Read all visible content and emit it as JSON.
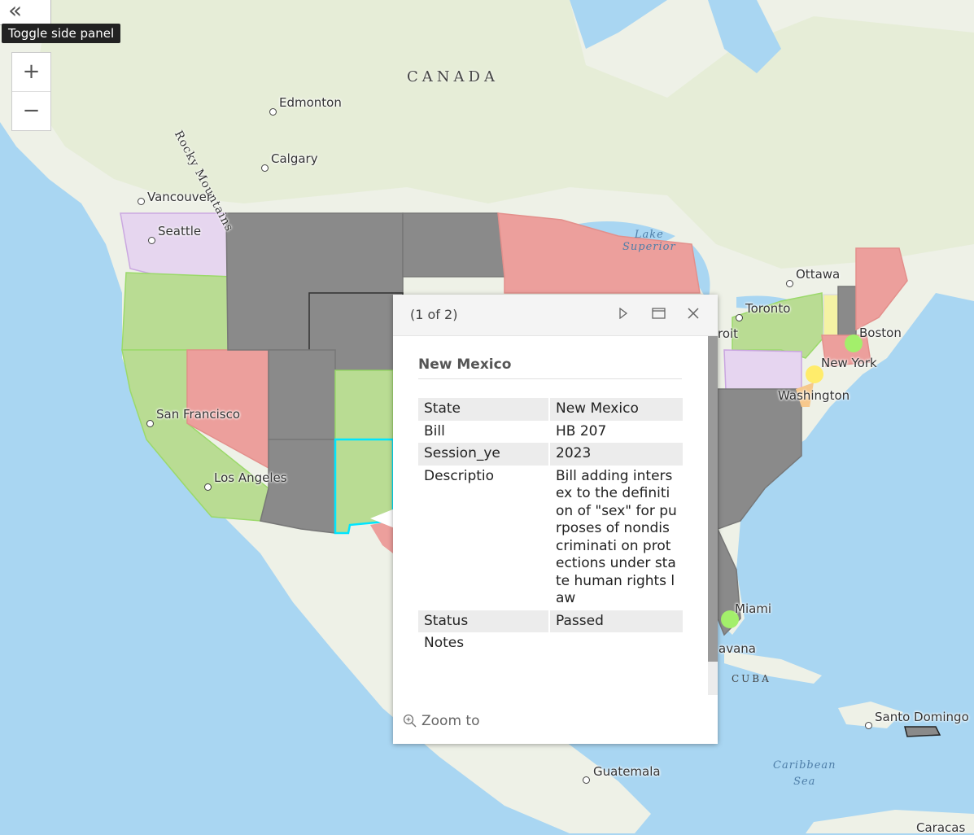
{
  "panel": {
    "toggle_icon": "chevron-double-left-icon",
    "tooltip": "Toggle side panel"
  },
  "zoom": {
    "in_label": "+",
    "out_label": "−"
  },
  "map": {
    "country_labels": [
      "CANADA",
      "CUBA"
    ],
    "water_labels": {
      "lake_superior_1": "Lake",
      "lake_superior_2": "Superior",
      "caribbean_1": "Caribbean",
      "caribbean_2": "Sea"
    },
    "mountain_label": "Rocky Mountains",
    "cities": {
      "edmonton": "Edmonton",
      "calgary": "Calgary",
      "vancouver": "Vancouver",
      "seattle": "Seattle",
      "san_francisco": "San Francisco",
      "los_angeles": "Los Angeles",
      "ottawa": "Ottawa",
      "toronto": "Toronto",
      "detroit_partial": "roit",
      "boston": "Boston",
      "new_york": "New York",
      "washington": "Washington",
      "miami": "Miami",
      "havana_partial": "avana",
      "santo_domingo": "Santo Domingo",
      "guatemala": "Guatemala",
      "caracas": "Caracas"
    },
    "colors": {
      "ocean": "#a9d6f2",
      "land": "#eef1e7",
      "gray": "#8a8a8a",
      "green": "#b9dc93",
      "red": "#ec9f9c",
      "purple": "#e6d5f0",
      "yellow": "#f4f2a4",
      "highlight": "#00e5ff"
    }
  },
  "popup": {
    "count": "(1 of 2)",
    "title": "New Mexico",
    "icons": {
      "next": "play-icon",
      "dock": "dock-icon",
      "close": "close-icon",
      "zoom": "zoom-in-icon"
    },
    "rows": [
      {
        "key": "State",
        "value": "New Mexico"
      },
      {
        "key": "Bill",
        "value": "HB 207"
      },
      {
        "key": "Session_ye",
        "value": "2023"
      },
      {
        "key": "Descriptio",
        "value": "Bill adding intersex to the definition of \"sex\" for purposes of nondiscriminati on protections under state human rights law"
      },
      {
        "key": "Status",
        "value": "Passed"
      },
      {
        "key": "Notes",
        "value": ""
      }
    ],
    "zoom_to": "Zoom to"
  }
}
